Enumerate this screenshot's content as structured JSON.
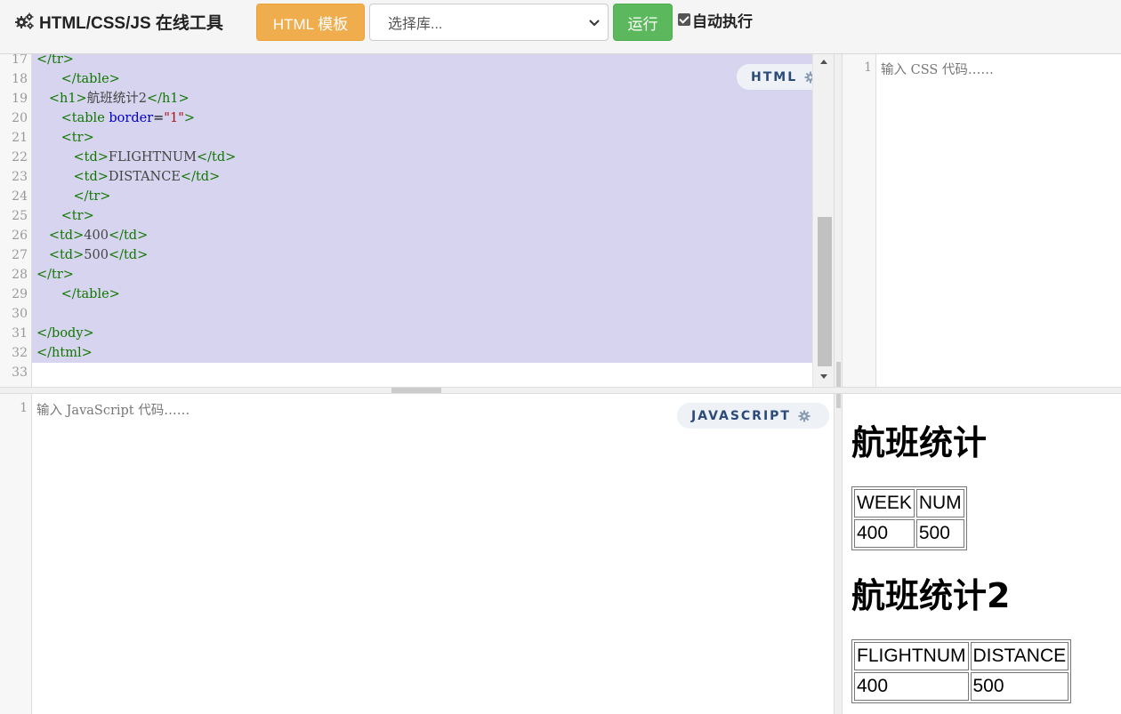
{
  "toolbar": {
    "brand": "HTML/CSS/JS 在线工具",
    "template_button": "HTML 模板",
    "library_select": "选择库...",
    "run_button": "运行",
    "auto_run_label": "自动执行",
    "auto_run_checked": true
  },
  "html_editor": {
    "badge": "HTML",
    "lines": [
      {
        "n": "17",
        "html": "<span class='tg'>&lt;/tr&gt;</span>"
      },
      {
        "n": "18",
        "html": "      <span class='tg'>&lt;/table&gt;</span>"
      },
      {
        "n": "19",
        "html": "   <span class='tg'>&lt;h1&gt;</span><span class='tx'>航班统计2</span><span class='tg'>&lt;/h1&gt;</span>"
      },
      {
        "n": "20",
        "html": "      <span class='tg'>&lt;table</span> <span class='at'>border</span>=<span class='st'>\"1\"</span><span class='tg'>&gt;</span>"
      },
      {
        "n": "21",
        "html": "      <span class='tg'>&lt;tr&gt;</span>"
      },
      {
        "n": "22",
        "html": "         <span class='tg'>&lt;td&gt;</span><span class='tx'>FLIGHTNUM</span><span class='tg'>&lt;/td&gt;</span>"
      },
      {
        "n": "23",
        "html": "         <span class='tg'>&lt;td&gt;</span><span class='tx'>DISTANCE</span><span class='tg'>&lt;/td&gt;</span>"
      },
      {
        "n": "24",
        "html": "         <span class='tg'>&lt;/tr&gt;</span>"
      },
      {
        "n": "25",
        "html": "      <span class='tg'>&lt;tr&gt;</span>"
      },
      {
        "n": "26",
        "html": "   <span class='tg'>&lt;td&gt;</span><span class='tx'>400</span><span class='tg'>&lt;/td&gt;</span>"
      },
      {
        "n": "27",
        "html": "   <span class='tg'>&lt;td&gt;</span><span class='tx'>500</span><span class='tg'>&lt;/td&gt;</span>"
      },
      {
        "n": "28",
        "html": "<span class='tg'>&lt;/tr&gt;</span>"
      },
      {
        "n": "29",
        "html": "      <span class='tg'>&lt;/table&gt;</span>"
      },
      {
        "n": "30",
        "html": ""
      },
      {
        "n": "31",
        "html": "<span class='tg'>&lt;/body&gt;</span>"
      },
      {
        "n": "32",
        "html": "<span class='tg'>&lt;/html&gt;</span>"
      },
      {
        "n": "33",
        "html": ""
      }
    ],
    "selected_through": "32"
  },
  "css_editor": {
    "line_number": "1",
    "placeholder": "输入 CSS 代码……"
  },
  "js_editor": {
    "badge": "JAVASCRIPT",
    "line_number": "1",
    "placeholder": "输入 JavaScript 代码……"
  },
  "preview": {
    "heading1": "航班统计",
    "table1": {
      "header": [
        "WEEK",
        "NUM"
      ],
      "row": [
        "400",
        "500"
      ]
    },
    "heading2": "航班统计2",
    "table2": {
      "header": [
        "FLIGHTNUM",
        "DISTANCE"
      ],
      "row": [
        "400",
        "500"
      ]
    }
  }
}
